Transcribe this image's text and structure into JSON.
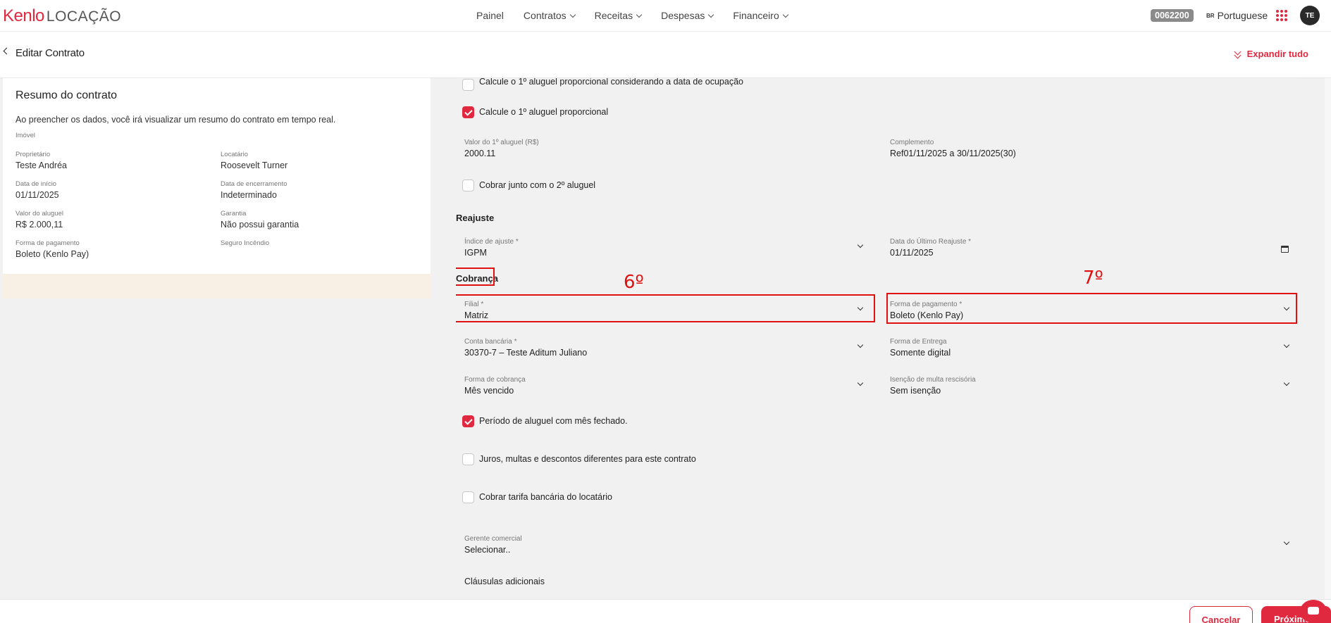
{
  "brand": {
    "name": "Kenlo",
    "product": "LOCAÇÃO"
  },
  "nav": [
    {
      "label": "Painel",
      "dropdown": false
    },
    {
      "label": "Contratos",
      "dropdown": true
    },
    {
      "label": "Receitas",
      "dropdown": true
    },
    {
      "label": "Despesas",
      "dropdown": true
    },
    {
      "label": "Financeiro",
      "dropdown": true
    }
  ],
  "account_code": "0062200",
  "language": {
    "flag": "BR",
    "label": "Portuguese"
  },
  "user_initials": "TE",
  "page_title": "Editar Contrato",
  "expand_all": "Expandir tudo",
  "summary": {
    "title": "Resumo do contrato",
    "description": "Ao preencher os dados, você irá visualizar um resumo do contrato em tempo real.",
    "imovel_label": "Imóvel",
    "fields": [
      {
        "label": "Proprietário",
        "value": "Teste Andréa"
      },
      {
        "label": "Locatário",
        "value": "Roosevelt Turner"
      },
      {
        "label": "Data de início",
        "value": "01/11/2025"
      },
      {
        "label": "Data de encerramento",
        "value": "Indeterminado"
      },
      {
        "label": "Valor do aluguel",
        "value": "R$ 2.000,11"
      },
      {
        "label": "Garantia",
        "value": "Não possui garantia"
      },
      {
        "label": "Forma de pagamento",
        "value": "Boleto (Kenlo Pay)"
      },
      {
        "label": "Seguro Incêndio",
        "value": ""
      }
    ]
  },
  "form": {
    "cut_checkbox_label": "Calcule o 1º aluguel proporcional considerando a data de ocupação",
    "proporcional": {
      "label": "Calcule o 1º aluguel proporcional",
      "checked": true
    },
    "valor_primeiro": {
      "label": "Valor do 1º aluguel (R$)",
      "value": "2000.11"
    },
    "complemento": {
      "label": "Complemento",
      "value": "Ref01/11/2025 a 30/11/2025(30)"
    },
    "cobrar_junto": {
      "label": "Cobrar junto com o 2º aluguel",
      "checked": false
    },
    "reajuste_title": "Reajuste",
    "indice": {
      "label": "Índice de ajuste *",
      "value": "IGPM"
    },
    "data_reajuste": {
      "label": "Data do Último Reajuste *",
      "value": "01/11/2025"
    },
    "cobranca_title": "Cobrança",
    "filial": {
      "label": "Filial *",
      "value": "Matriz"
    },
    "forma_pagamento": {
      "label": "Forma de pagamento *",
      "value": "Boleto (Kenlo Pay)"
    },
    "conta_bancaria": {
      "label": "Conta bancária *",
      "value": "30370-7 – Teste Aditum Juliano"
    },
    "forma_entrega": {
      "label": "Forma de Entrega",
      "value": "Somente digital"
    },
    "forma_cobranca": {
      "label": "Forma de cobrança",
      "value": "Mês vencido"
    },
    "isencao": {
      "label": "Isenção de multa rescisória",
      "value": "Sem isenção"
    },
    "mes_fechado": {
      "label": "Período de aluguel com mês fechado.",
      "checked": true
    },
    "juros": {
      "label": "Juros, multas e descontos diferentes para este contrato",
      "checked": false
    },
    "tarifa": {
      "label": "Cobrar tarifa bancária do locatário",
      "checked": false
    },
    "gerente": {
      "label": "Gerente comercial",
      "value": "Selecionar.."
    },
    "clausulas": {
      "label": "Cláusulas adicionais"
    }
  },
  "annotations": {
    "six": "6º",
    "seven": "7º"
  },
  "actions": {
    "cancel": "Cancelar",
    "next": "Próximo"
  },
  "colors": {
    "accent": "#e0283f",
    "annotation": "#e01010"
  }
}
